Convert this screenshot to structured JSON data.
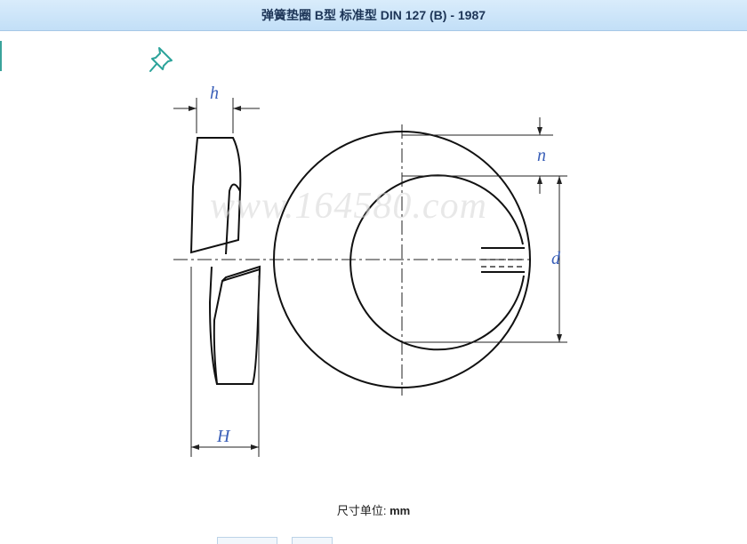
{
  "header": {
    "title": "弹簧垫圈 B型 标准型 DIN 127 (B) - 1987"
  },
  "toolbar": {
    "pin_icon": "pushpin-icon"
  },
  "diagram": {
    "watermark": "www.164580.com",
    "labels": {
      "h": "h",
      "n": "n",
      "d": "d",
      "H": "H"
    }
  },
  "footer": {
    "units_label": "尺寸单位:",
    "units_value": "mm"
  },
  "colors": {
    "title_bg": "#c2dff7",
    "dim_text": "#3a5fb8",
    "accent": "#3aa39b"
  }
}
